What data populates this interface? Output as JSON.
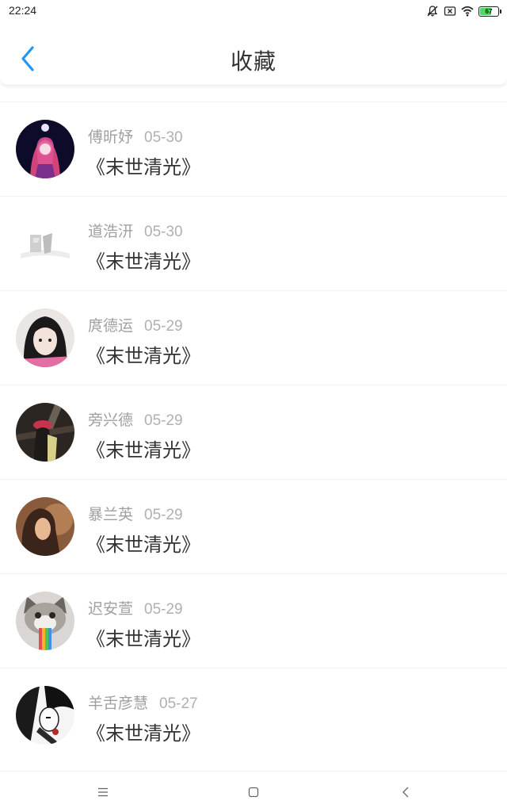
{
  "status_bar": {
    "time": "22:24",
    "battery_level": "67",
    "battery_fraction": 0.67,
    "icons": [
      "notifications-muted-icon",
      "no-sim-icon",
      "wifi-icon",
      "battery-icon"
    ]
  },
  "header": {
    "title": "收藏",
    "back_icon": "chevron-left-icon"
  },
  "colors": {
    "accent": "#2196f3",
    "battery": "#4cd964",
    "meta_text": "#a0a0a0",
    "title_text": "#333333"
  },
  "favorites": [
    {
      "author": "傅昕妤",
      "date": "05-30",
      "title": "《末世清光》"
    },
    {
      "author": "道浩汧",
      "date": "05-30",
      "title": "《末世清光》"
    },
    {
      "author": "庹德运",
      "date": "05-29",
      "title": "《末世清光》"
    },
    {
      "author": "旁兴德",
      "date": "05-29",
      "title": "《末世清光》"
    },
    {
      "author": "暴兰英",
      "date": "05-29",
      "title": "《末世清光》"
    },
    {
      "author": "迟安萱",
      "date": "05-29",
      "title": "《末世清光》"
    },
    {
      "author": "羊舌彦慧",
      "date": "05-27",
      "title": "《末世清光》"
    }
  ],
  "nav": {
    "icons": [
      "menu-icon",
      "home-icon",
      "back-icon"
    ]
  }
}
